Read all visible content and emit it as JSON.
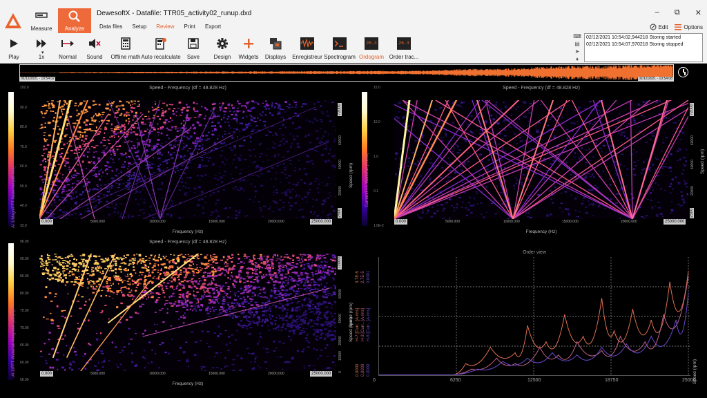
{
  "ribbon": {
    "measure_label": "Measure",
    "analyze_label": "Analyze",
    "title": "DewesoftX - Datafile: TTR05_activity02_runup.dxd",
    "menu": [
      "Data files",
      "Setup",
      "Review",
      "Print",
      "Export"
    ],
    "menu_active": "Review",
    "edit_label": "Edit",
    "options_label": "Options"
  },
  "toolbar": {
    "play": "Play",
    "speed": "1x",
    "normal": "Normal",
    "sound": "Sound",
    "offline_math": "Offline math",
    "auto_recalculate": "Auto recalculate",
    "save": "Save",
    "design": "Design",
    "widgets": "Widgets",
    "displays": "Displays",
    "enregistreur": "Enregistreur",
    "spectrogram": "Spectrogram",
    "ordogram": "Ordogram",
    "order_tracking": "Order trac...",
    "ordogram_badge": "26.3",
    "order_badge": "26.3"
  },
  "events": [
    "02/12/2021 10:54:02,944218 Storing started",
    "02/12/2021 10:54:07,970218 Storing stopped"
  ],
  "timeline": {
    "start": "02/12/2021 - 10:54:02",
    "end": "02/12/2021 - 10:54:08"
  },
  "plots": {
    "p1": {
      "title": "Speed - Frequency (df = 48.828 Hz)",
      "cbar_label": "AI 1/Magn/FFT Waterfall (dB m/s)",
      "cbar_ticks": [
        "102.0",
        "90.0",
        "80.0",
        "70.0",
        "60.0",
        "50.0",
        "40.0",
        "32.0"
      ],
      "xlabel": "Frequency (Hz)",
      "xstart": "0.000",
      "xend": "25000.000",
      "xticks": [
        "5000.000",
        "10000.000",
        "15000.000",
        "20000.000"
      ],
      "rlabel": "Speed (rpm)",
      "rticks": [
        "72000",
        "60000",
        "40000",
        "20000"
      ],
      "rmin": "2500"
    },
    "p2": {
      "title": "Speed - Frequency (df = 48.828 Hz)",
      "cbar_label": "Current/FFT Waterfall (A rms)",
      "cbar_ticks": [
        "15.0",
        "10.0",
        "1.0",
        "0.1",
        "1.0E-2"
      ],
      "xlabel": "Frequency (Hz)",
      "xstart": "0.000",
      "xend": "25000.000",
      "xticks": [
        "5000.000",
        "10000.000",
        "15000.000",
        "20000.000"
      ],
      "rlabel": "Speed (rpm)",
      "rticks": [
        "72000",
        "60000",
        "40000",
        "20000"
      ],
      "rmin": "2500"
    },
    "p3": {
      "title": "Speed - Frequency (df = 48.828 Hz)",
      "cbar_label": "AI 2/FFT Waterfall Weighted (dB (A))",
      "cbar_ticks": [
        "96.00",
        "90.00",
        "85.00",
        "80.00",
        "75.00",
        "70.00",
        "65.00",
        "60.00",
        "56.00"
      ],
      "xlabel": "Frequency (Hz)",
      "xstart": "0.000",
      "xend": "25000.000",
      "xticks": [
        "5000.000",
        "10000.000",
        "15000.000",
        "20000.000"
      ],
      "rlabel": "Speed (rpm)",
      "rticks": [
        "72000",
        "60000",
        "40000",
        "20000",
        "10000"
      ],
      "rmin": "0"
    },
    "p4": {
      "title": "Order view",
      "ylabels": [
        "H-7 [Curr.. [A rms]",
        "H-3 [Curr.. [A rms]",
        "H-5 [Curr.. [A rms]"
      ],
      "ytop": [
        "3.7E-5",
        "2.7E-5",
        "0.0001"
      ],
      "ybottom": [
        "0.0000",
        "0.0000",
        "0.0000"
      ],
      "speed_label": "Speed (rpm)"
    }
  },
  "chart_data": {
    "type": "line",
    "title": "Order view",
    "xlabel": "Speed (rpm)",
    "x": [
      0,
      6250,
      12500,
      18750,
      25000
    ],
    "xlim": [
      0,
      25000
    ],
    "series": [
      {
        "name": "H-7 [Curr.. [A rms]",
        "color": "#e07050",
        "x": [
          0,
          6000,
          7000,
          9000,
          11000,
          12000,
          13500,
          15000,
          16500,
          18000,
          19000,
          20500,
          22000,
          23500,
          25000
        ],
        "y": [
          0,
          0,
          0.1,
          0.25,
          0.2,
          0.45,
          0.3,
          0.55,
          0.35,
          0.7,
          0.4,
          0.6,
          0.5,
          0.85,
          0.95
        ]
      },
      {
        "name": "H-3 [Curr.. [A rms]",
        "color": "#c0608a",
        "x": [
          0,
          6000,
          7500,
          9500,
          11000,
          13000,
          14500,
          16000,
          18000,
          19500,
          21500,
          23000,
          25000
        ],
        "y": [
          0,
          0,
          0.05,
          0.15,
          0.1,
          0.25,
          0.18,
          0.3,
          0.22,
          0.35,
          0.3,
          0.55,
          0.9
        ]
      },
      {
        "name": "H-5 [Curr.. [A rms]",
        "color": "#6a4ad0",
        "x": [
          0,
          6000,
          8000,
          10000,
          12000,
          14000,
          16000,
          18000,
          20000,
          22000,
          24000,
          25000
        ],
        "y": [
          0,
          0,
          0.05,
          0.12,
          0.15,
          0.2,
          0.18,
          0.25,
          0.28,
          0.35,
          0.5,
          0.75
        ]
      }
    ],
    "grid": true
  }
}
